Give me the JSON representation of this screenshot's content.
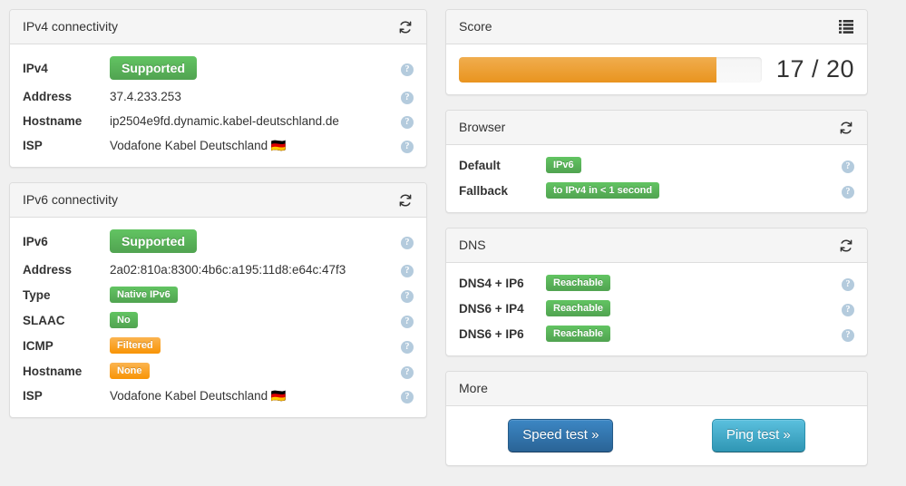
{
  "panels": {
    "ipv4": {
      "title": "IPv4 connectivity",
      "head_icon": "refresh-icon",
      "rows": [
        {
          "label": "IPv4",
          "kind": "badge",
          "badge_size": "lg",
          "badge_color": "green",
          "value": "Supported",
          "help": "?"
        },
        {
          "label": "Address",
          "kind": "link",
          "value": "37.4.233.253",
          "help": "?"
        },
        {
          "label": "Hostname",
          "kind": "text",
          "value": "ip2504e9fd.dynamic.kabel-deutschland.de",
          "help": "?"
        },
        {
          "label": "ISP",
          "kind": "text",
          "value": "Vodafone Kabel Deutschland 🇩🇪",
          "help": "?"
        }
      ]
    },
    "ipv6": {
      "title": "IPv6 connectivity",
      "head_icon": "refresh-icon",
      "rows": [
        {
          "label": "IPv6",
          "kind": "badge",
          "badge_size": "lg",
          "badge_color": "green",
          "value": "Supported",
          "help": "?"
        },
        {
          "label": "Address",
          "kind": "link",
          "value": "2a02:810a:8300:4b6c:a195:11d8:e64c:47f3",
          "help": "?"
        },
        {
          "label": "Type",
          "kind": "badge",
          "badge_size": "sm",
          "badge_color": "green",
          "value": "Native IPv6",
          "help": "?"
        },
        {
          "label": "SLAAC",
          "kind": "badge",
          "badge_size": "sm",
          "badge_color": "green",
          "value": "No",
          "help": "?"
        },
        {
          "label": "ICMP",
          "kind": "badge",
          "badge_size": "sm",
          "badge_color": "orange",
          "value": "Filtered",
          "help": "?"
        },
        {
          "label": "Hostname",
          "kind": "badge",
          "badge_size": "sm",
          "badge_color": "orange",
          "value": "None",
          "help": "?"
        },
        {
          "label": "ISP",
          "kind": "text",
          "value": "Vodafone Kabel Deutschland 🇩🇪",
          "help": "?"
        }
      ]
    },
    "score": {
      "title": "Score",
      "head_icon": "list-icon",
      "value": 17,
      "max": 20,
      "display": "17 / 20",
      "percent": 85,
      "bar_color": "#ee9b2c",
      "track_color": "#f1f1f1"
    },
    "browser": {
      "title": "Browser",
      "head_icon": "refresh-icon",
      "rows": [
        {
          "label": "Default",
          "kind": "badge",
          "badge_size": "sm",
          "badge_color": "green",
          "value": "IPv6",
          "help": "?"
        },
        {
          "label": "Fallback",
          "kind": "badge",
          "badge_size": "sm",
          "badge_color": "green",
          "value": "to IPv4 in < 1 second",
          "help": "?"
        }
      ]
    },
    "dns": {
      "title": "DNS",
      "head_icon": "refresh-icon",
      "rows": [
        {
          "label": "DNS4 + IP6",
          "kind": "badge",
          "badge_size": "sm",
          "badge_color": "green",
          "value": "Reachable",
          "help": "?"
        },
        {
          "label": "DNS6 + IP4",
          "kind": "badge",
          "badge_size": "sm",
          "badge_color": "green",
          "value": "Reachable",
          "help": "?"
        },
        {
          "label": "DNS6 + IP6",
          "kind": "badge",
          "badge_size": "sm",
          "badge_color": "green",
          "value": "Reachable",
          "help": "?"
        }
      ]
    },
    "more": {
      "title": "More",
      "buttons": [
        {
          "label": "Speed test »",
          "style": "primary",
          "color": "#2a6496"
        },
        {
          "label": "Ping test »",
          "style": "info",
          "color": "#2f96b4"
        }
      ]
    }
  }
}
